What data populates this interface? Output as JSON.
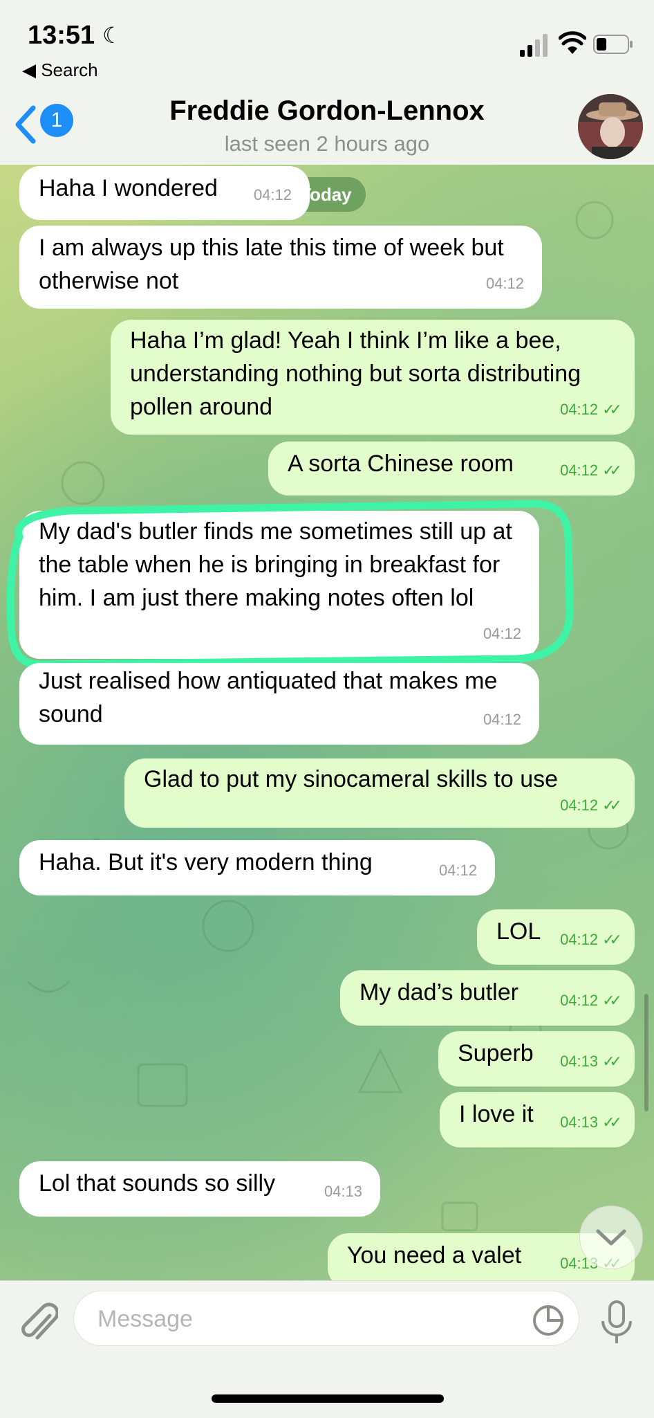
{
  "status_bar": {
    "time": "13:51",
    "back_app": "◀ Search"
  },
  "header": {
    "back_badge": "1",
    "contact_name": "Freddie Gordon-Lennox",
    "contact_status": "last seen 2 hours ago"
  },
  "chat": {
    "date_pill": "Today",
    "messages": [
      {
        "dir": "in",
        "text": "Haha I wondered",
        "time": "04:12"
      },
      {
        "dir": "in",
        "text": "I am always up this late this time of week but otherwise not",
        "time": "04:12"
      },
      {
        "dir": "out",
        "text": "Haha I’m glad! Yeah I think I’m like a bee, understanding nothing but sorta distributing pollen around",
        "time": "04:12",
        "ticks": "✓✓"
      },
      {
        "dir": "out",
        "text": "A sorta Chinese room",
        "time": "04:12",
        "ticks": "✓✓"
      },
      {
        "dir": "in",
        "text": "My dad's butler finds me sometimes still up at the table when he is bringing in breakfast for him. I am just there making notes often lol",
        "time": "04:12"
      },
      {
        "dir": "in",
        "text": "Just realised how antiquated that makes me sound",
        "time": "04:12"
      },
      {
        "dir": "out",
        "text": "Glad to put my sinocameral skills to use",
        "time": "04:12",
        "ticks": "✓✓"
      },
      {
        "dir": "in",
        "text": "Haha. But it's very modern thing",
        "time": "04:12"
      },
      {
        "dir": "out",
        "text": "LOL",
        "time": "04:12",
        "ticks": "✓✓"
      },
      {
        "dir": "out",
        "text": "My dad’s butler",
        "time": "04:12",
        "ticks": "✓✓"
      },
      {
        "dir": "out",
        "text": "Superb",
        "time": "04:13",
        "ticks": "✓✓"
      },
      {
        "dir": "out",
        "text": "I love it",
        "time": "04:13",
        "ticks": "✓✓"
      },
      {
        "dir": "in",
        "text": "Lol that sounds so silly",
        "time": "04:13"
      },
      {
        "dir": "out",
        "text": "You need a valet",
        "time": "04:13",
        "ticks": "✓✓"
      }
    ]
  },
  "input": {
    "placeholder": "Message"
  },
  "colors": {
    "accent": "#1e8ef7",
    "outgoing": "#e3fccb",
    "incoming": "#ffffff",
    "highlight": "#3ef2a6"
  },
  "icons": [
    "moon-icon",
    "signal-icon",
    "wifi-icon",
    "battery-icon",
    "back-chevron-icon",
    "paperclip-icon",
    "sticker-icon",
    "microphone-icon",
    "chevron-down-icon"
  ]
}
